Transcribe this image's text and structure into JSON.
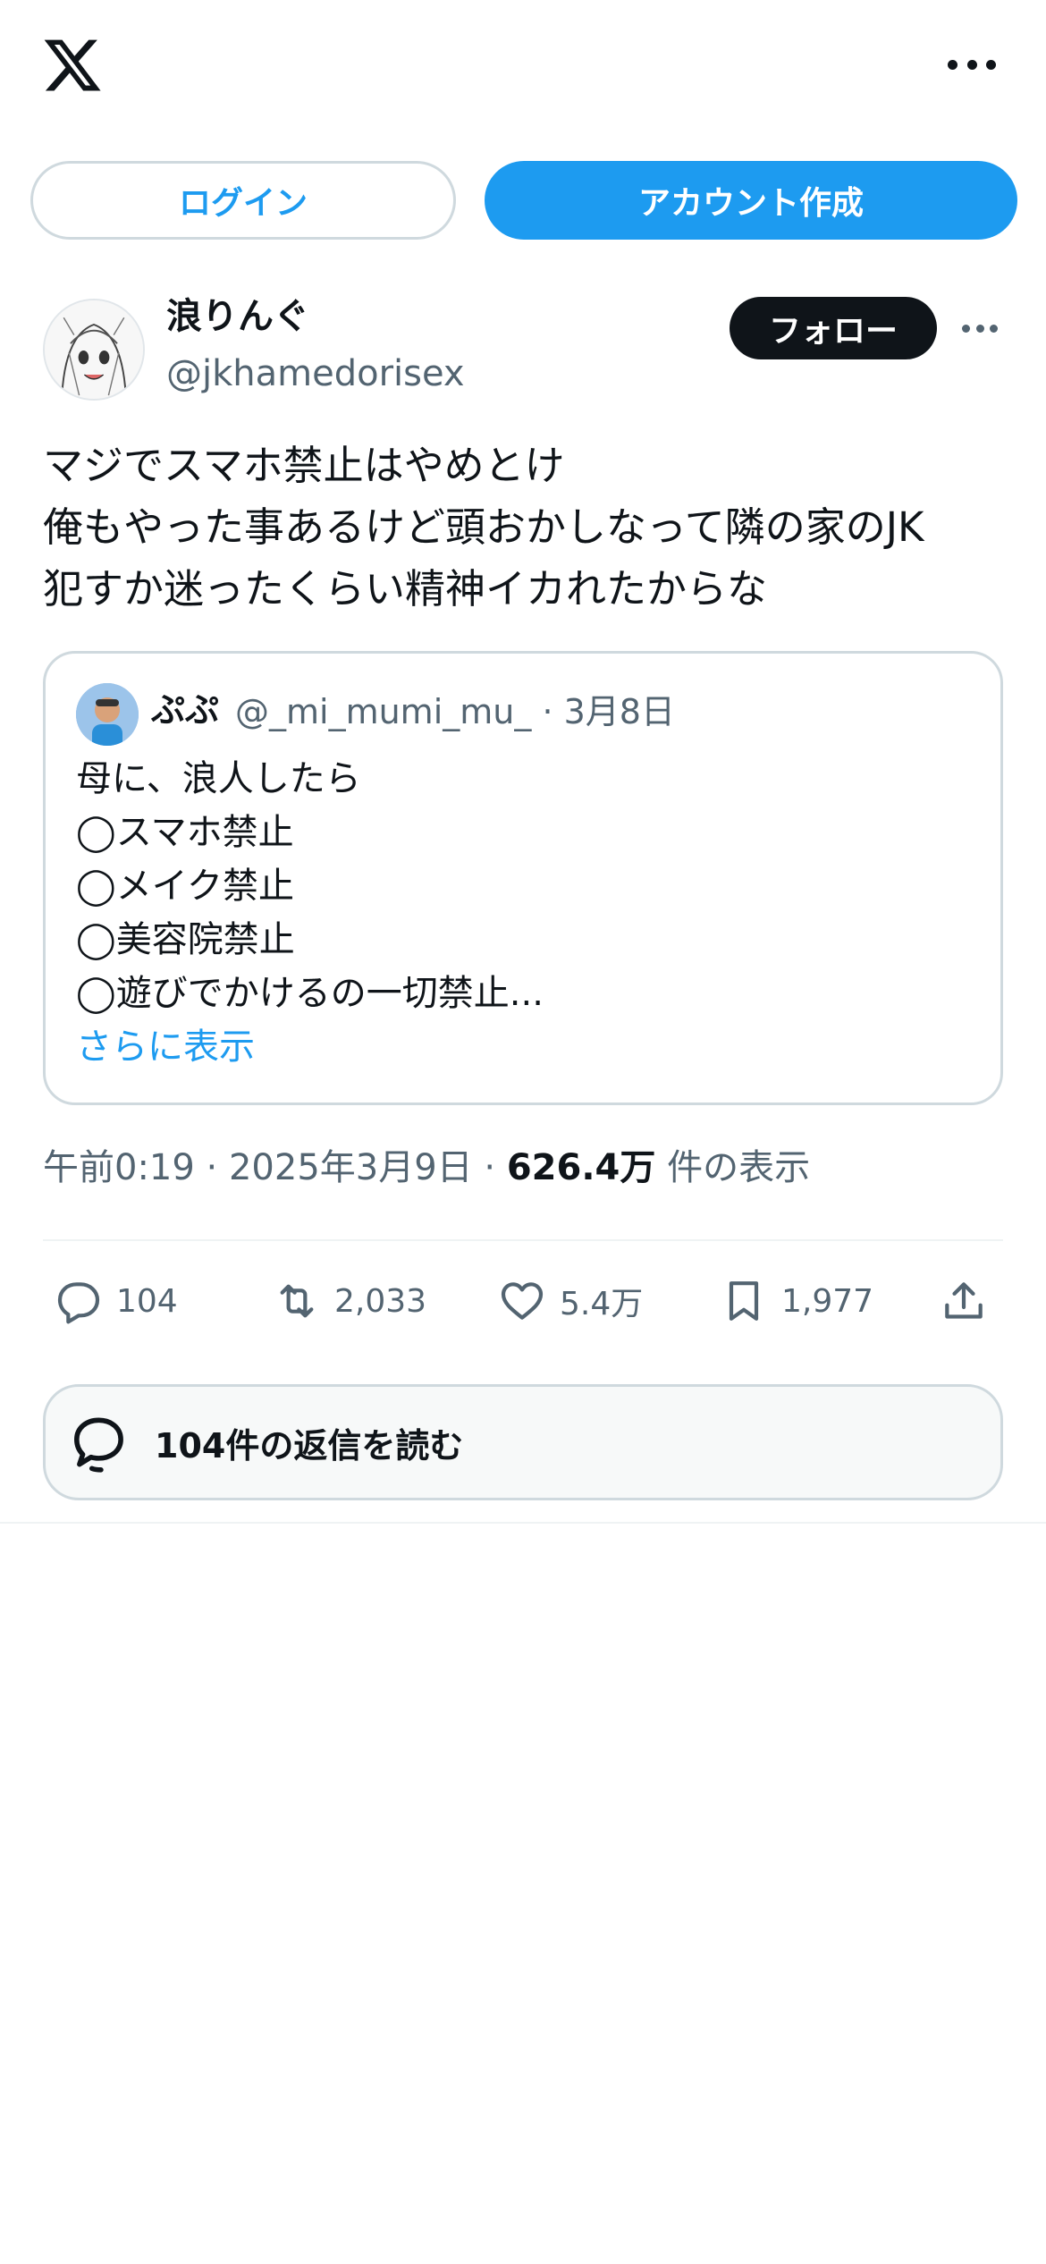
{
  "header": {
    "login_label": "ログイン",
    "signup_label": "アカウント作成"
  },
  "tweet": {
    "author_name": "浪りんぐ",
    "author_handle": "@jkhamedorisex",
    "follow_label": "フォロー",
    "text": "マジでスマホ禁止はやめとけ\n俺もやった事あるけど頭おかしなって隣の家のJK\n犯すか迷ったくらい精神イカれたからな",
    "quote": {
      "author_name": "ぷぷ",
      "author_handle": "@_mi_mumi_mu_",
      "date": "3月8日",
      "text": "母に、浪人したら\n◯スマホ禁止\n◯メイク禁止\n◯美容院禁止\n◯遊びでかけるの一切禁止...",
      "show_more": "さらに表示"
    },
    "time": "午前0:19",
    "date": "2025年3月9日",
    "views_count": "626.4万",
    "views_label": "件の表示",
    "stats": {
      "replies": "104",
      "retweets": "2,033",
      "likes": "5.4万",
      "bookmarks": "1,977"
    },
    "read_replies_label": "104件の返信を読む"
  },
  "colors": {
    "accent": "#1d9bf0",
    "text_primary": "#0f1419",
    "text_secondary": "#536471",
    "border": "#cfd9de"
  },
  "icons": [
    "x-logo-icon",
    "more-icon",
    "reply-icon",
    "retweet-icon",
    "like-icon",
    "bookmark-icon",
    "share-icon",
    "replies-bubble-icon"
  ]
}
